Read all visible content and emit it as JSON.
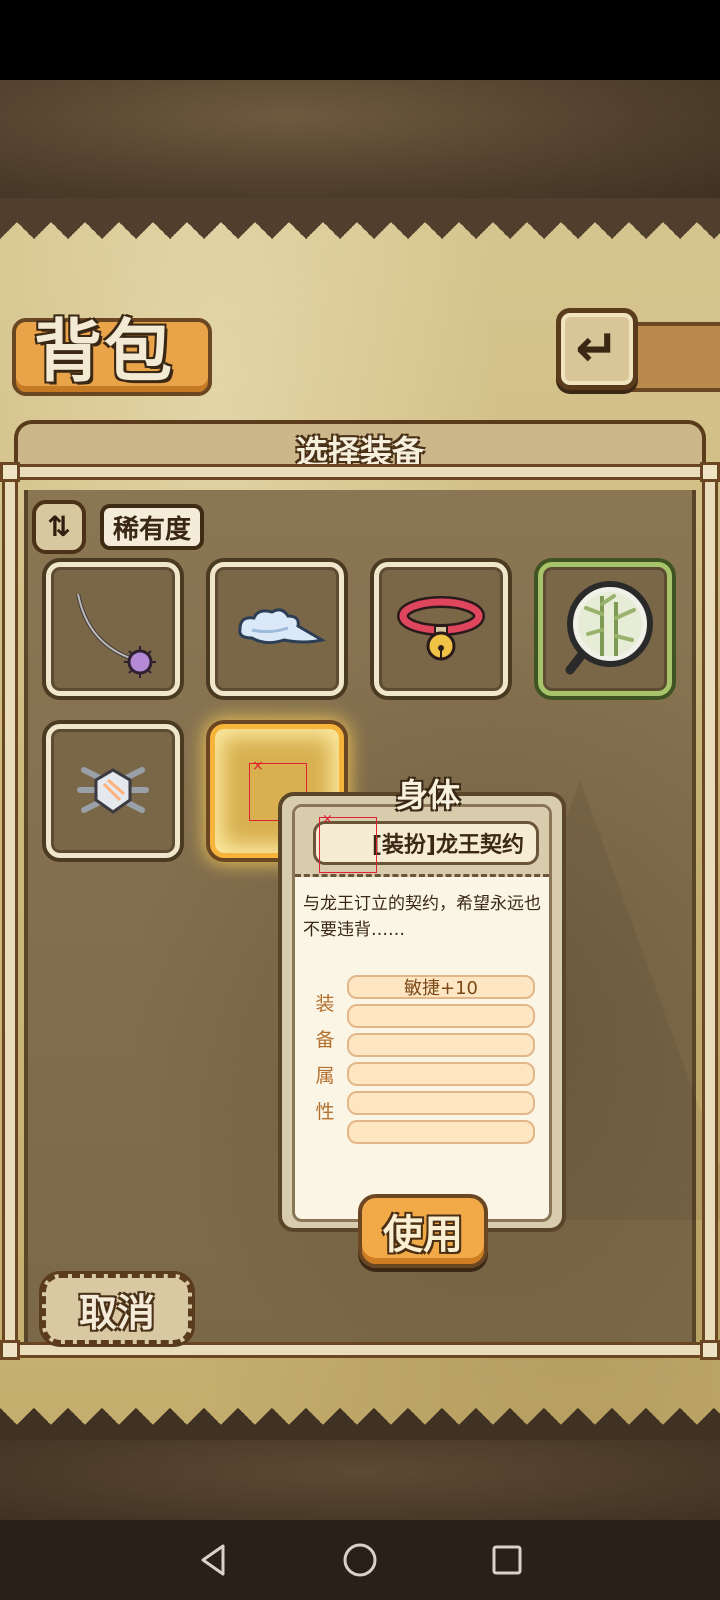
{
  "screen": {
    "title": "背包",
    "section_title": "选择装备",
    "rarity_label": "稀有度",
    "cancel_label": "取消"
  },
  "inventory": {
    "slots": [
      {
        "icon": "whip-icon",
        "state": "normal"
      },
      {
        "icon": "cloud-scarf-icon",
        "state": "normal"
      },
      {
        "icon": "bell-collar-icon",
        "state": "normal"
      },
      {
        "icon": "bamboo-mirror-icon",
        "state": "rare"
      },
      {
        "icon": "silver-gem-icon",
        "state": "normal"
      },
      {
        "icon": "missing-image-icon",
        "state": "selected"
      }
    ]
  },
  "popup": {
    "slot_type": "身体",
    "item_name": "[装扮]龙王契约",
    "description": "与龙王订立的契约，希望永远也不要违背……",
    "attr_header": [
      "装",
      "备",
      "属",
      "性"
    ],
    "attributes": [
      "敏捷+10",
      "",
      "",
      "",
      "",
      ""
    ],
    "use_label": "使用"
  },
  "colors": {
    "accent_orange": "#f2a948",
    "parchment": "#d6c58f",
    "dark_brown": "#5a3b1c",
    "rare_green": "#a8c46a"
  }
}
